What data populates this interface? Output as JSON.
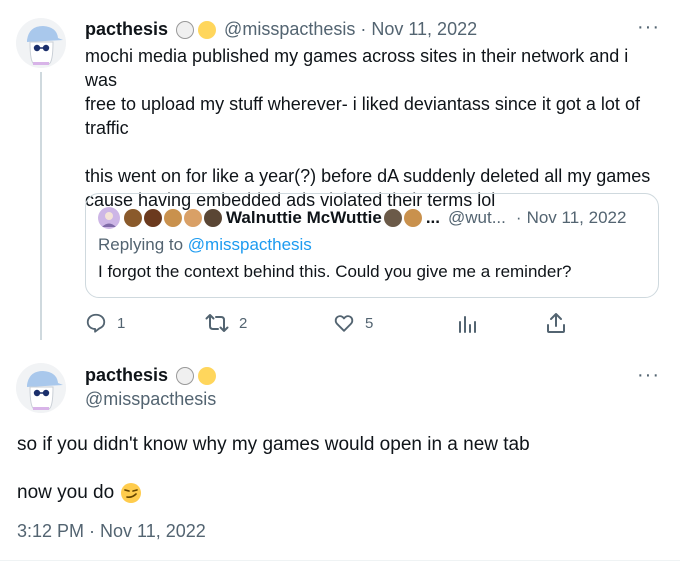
{
  "tweet1": {
    "display_name": "pacthesis",
    "handle": "@misspacthesis",
    "separator": "·",
    "date": "Nov 11, 2022",
    "more_label": "···",
    "text": "mochi media published my games across sites in their network and i was\nfree to upload my stuff wherever- i liked deviantass since it got a lot of\ntraffic\n\nthis went on for like a year(?) before dA suddenly deleted all my games\ncause having embedded ads violated their terms lol",
    "badges": [
      "ghost-icon",
      "yellow-heart-icon"
    ],
    "quote": {
      "display_name": "Walnuttie McWuttie",
      "name_ellipsis": "...",
      "handle": "@wut...",
      "separator": "·",
      "date": "Nov 11, 2022",
      "replying_prefix": "Replying to",
      "replying_handle": "@misspacthesis",
      "text": "I forgot the context behind this. Could you give me a reminder?"
    },
    "actions": {
      "reply_count": "1",
      "retweet_count": "2",
      "like_count": "5"
    }
  },
  "tweet2": {
    "display_name": "pacthesis",
    "handle": "@misspacthesis",
    "more_label": "···",
    "line1": "so if you didn't know why my games would open in a new tab",
    "line2": "now you do",
    "timestamp": "3:12 PM · Nov 11, 2022"
  },
  "colors": {
    "text": "#0f1419",
    "muted": "#536471",
    "border": "#cfd9de",
    "link": "#1d9bf0"
  }
}
